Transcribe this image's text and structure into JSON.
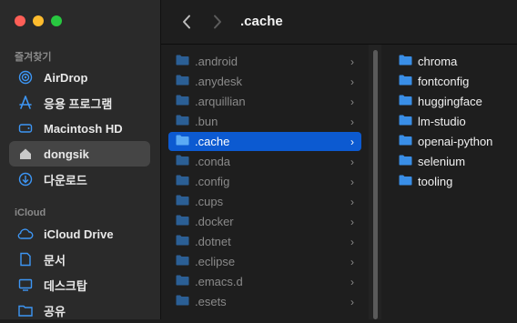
{
  "window": {
    "title": ".cache"
  },
  "sidebar": {
    "favorites_title": "즐겨찾기",
    "favorites": [
      {
        "label": "AirDrop",
        "icon": "airdrop-icon"
      },
      {
        "label": "응용 프로그램",
        "icon": "applications-icon"
      },
      {
        "label": "Macintosh HD",
        "icon": "drive-icon"
      },
      {
        "label": "dongsik",
        "icon": "home-icon",
        "active": true
      },
      {
        "label": "다운로드",
        "icon": "downloads-icon"
      }
    ],
    "icloud_title": "iCloud",
    "icloud": [
      {
        "label": "iCloud Drive",
        "icon": "icloud-icon"
      },
      {
        "label": "문서",
        "icon": "document-icon"
      },
      {
        "label": "데스크탑",
        "icon": "desktop-icon"
      },
      {
        "label": "공유",
        "icon": "shared-folder-icon"
      }
    ]
  },
  "column1": {
    "items": [
      {
        "name": ".android"
      },
      {
        "name": ".anydesk"
      },
      {
        "name": ".arquillian"
      },
      {
        "name": ".bun"
      },
      {
        "name": ".cache",
        "selected": true
      },
      {
        "name": ".conda"
      },
      {
        "name": ".config"
      },
      {
        "name": ".cups"
      },
      {
        "name": ".docker"
      },
      {
        "name": ".dotnet"
      },
      {
        "name": ".eclipse"
      },
      {
        "name": ".emacs.d"
      },
      {
        "name": ".esets"
      }
    ]
  },
  "column2": {
    "items": [
      {
        "name": "chroma"
      },
      {
        "name": "fontconfig"
      },
      {
        "name": "huggingface"
      },
      {
        "name": "lm-studio"
      },
      {
        "name": "openai-python"
      },
      {
        "name": "selenium"
      },
      {
        "name": "tooling"
      }
    ]
  },
  "colors": {
    "accent": "#0c5ad1",
    "folder_blue": "#3a8ee6",
    "folder_dim": "#2c5f95"
  }
}
